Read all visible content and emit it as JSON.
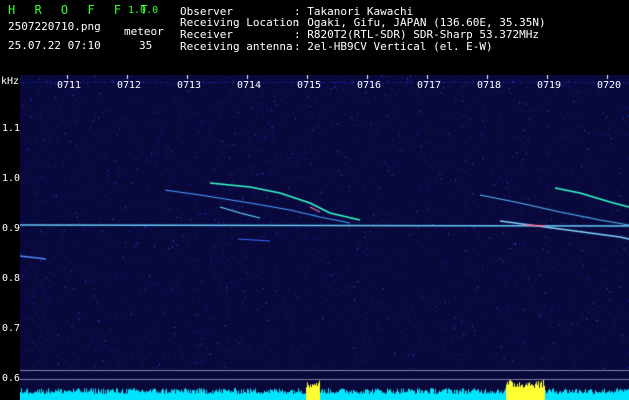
{
  "app": {
    "name": "H R O F F T",
    "version": "1.0.0",
    "filename": "2507220710.png",
    "datetime": "25.07.22 07:10",
    "counter_label": "meteor",
    "counter_value": "35"
  },
  "info": {
    "observer_label": "Observer",
    "observer_value": ": Takanori Kawachi",
    "location_label": "Receiving Location",
    "location_value": ": Ogaki, Gifu, JAPAN (136.60E, 35.35N)",
    "receiver_label": "Receiver",
    "receiver_value": ": R820T2(RTL-SDR) SDR-Sharp 53.372MHz",
    "antenna_label": "Receiving antenna",
    "antenna_value": ": 2el-HB9CV Vertical (el. E-W)"
  },
  "axis": {
    "y_unit": "kHz",
    "y_ticks": [
      "1.1",
      "1.0",
      "0.9",
      "0.8",
      "0.7",
      "0.6"
    ],
    "x_ticks": [
      "0711",
      "0712",
      "0713",
      "0714",
      "0715",
      "0716",
      "0717",
      "0718",
      "0719",
      "0720"
    ]
  },
  "colors": {
    "header_green": "#33ff33",
    "background": "#08083a",
    "carrier": "#66ccff",
    "meteor_trail": "#33ffcc",
    "noise_bar": "#00e5ff",
    "noise_peak": "#ffff33"
  }
}
